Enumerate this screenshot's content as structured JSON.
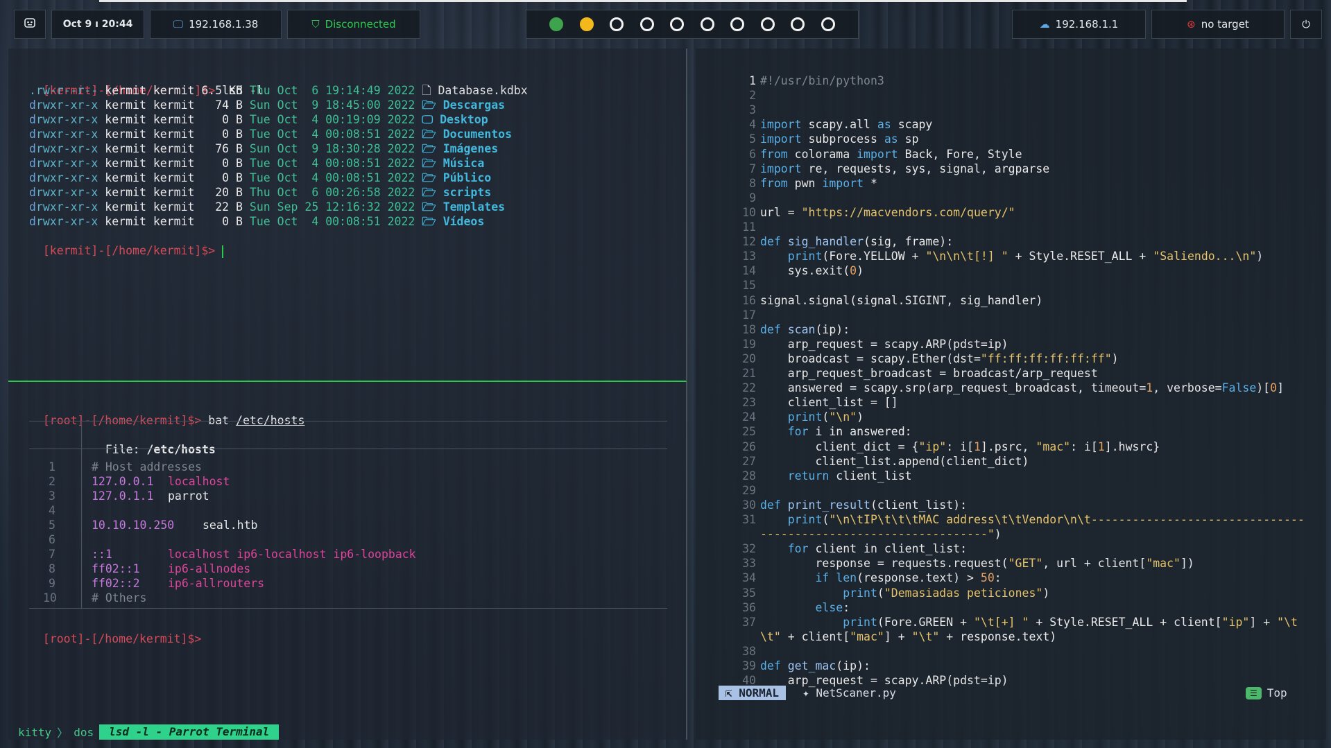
{
  "topbar": {
    "datetime": "Oct 9 ı 20:44",
    "local_ip": "192.168.1.38",
    "vpn_status": "Disconnected",
    "workspaces": [
      "active",
      "occupied",
      "empty",
      "empty",
      "empty",
      "empty",
      "empty",
      "empty",
      "empty",
      "empty"
    ],
    "gateway_ip": "192.168.1.1",
    "target": "no target",
    "colors": {
      "active": "#3fa34d",
      "occupied": "#f3b81c",
      "vpn": "#2ac94e"
    }
  },
  "terminal_top": {
    "prompt": "[kermit]-[/home/kermit]$>",
    "command": "lsd -l",
    "rows": [
      {
        "perm": ".rw-r--r--",
        "user": "kermit",
        "group": "kermit",
        "size": "6.5 KB",
        "date": "Thu Oct  6 19:14:49 2022",
        "icon": "🗋",
        "name": "Database.kdbx",
        "dir": false
      },
      {
        "perm": "drwxr-xr-x",
        "user": "kermit",
        "group": "kermit",
        "size": " 74 B",
        "date": "Sun Oct  9 18:45:00 2022",
        "icon": "🗁",
        "name": "Descargas",
        "dir": true
      },
      {
        "perm": "drwxr-xr-x",
        "user": "kermit",
        "group": "kermit",
        "size": "  0 B",
        "date": "Tue Oct  4 00:19:09 2022",
        "icon": "🖵",
        "name": "Desktop",
        "dir": true
      },
      {
        "perm": "drwxr-xr-x",
        "user": "kermit",
        "group": "kermit",
        "size": "  0 B",
        "date": "Tue Oct  4 00:08:51 2022",
        "icon": "🗁",
        "name": "Documentos",
        "dir": true
      },
      {
        "perm": "drwxr-xr-x",
        "user": "kermit",
        "group": "kermit",
        "size": " 76 B",
        "date": "Sun Oct  9 18:30:28 2022",
        "icon": "🗁",
        "name": "Imágenes",
        "dir": true
      },
      {
        "perm": "drwxr-xr-x",
        "user": "kermit",
        "group": "kermit",
        "size": "  0 B",
        "date": "Tue Oct  4 00:08:51 2022",
        "icon": "🗁",
        "name": "Música",
        "dir": true
      },
      {
        "perm": "drwxr-xr-x",
        "user": "kermit",
        "group": "kermit",
        "size": "  0 B",
        "date": "Tue Oct  4 00:08:51 2022",
        "icon": "🗁",
        "name": "Público",
        "dir": true
      },
      {
        "perm": "drwxr-xr-x",
        "user": "kermit",
        "group": "kermit",
        "size": " 20 B",
        "date": "Thu Oct  6 00:26:58 2022",
        "icon": "🗁",
        "name": "scripts",
        "dir": true
      },
      {
        "perm": "drwxr-xr-x",
        "user": "kermit",
        "group": "kermit",
        "size": " 22 B",
        "date": "Sun Sep 25 12:16:32 2022",
        "icon": "🗁",
        "name": "Templates",
        "dir": true
      },
      {
        "perm": "drwxr-xr-x",
        "user": "kermit",
        "group": "kermit",
        "size": "  0 B",
        "date": "Tue Oct  4 00:08:51 2022",
        "icon": "🗁",
        "name": "Vídeos",
        "dir": true
      }
    ],
    "prompt2": "[kermit]-[/home/kermit]$>"
  },
  "terminal_bottom": {
    "prompt": "[root]-[/home/kermit]$>",
    "command": "bat",
    "arg": "/etc/hosts",
    "file_label": "File:",
    "file_name": "/etc/hosts",
    "lines": [
      {
        "n": "1",
        "a": "# Host addresses",
        "b": "",
        "kind": "comment"
      },
      {
        "n": "2",
        "a": "127.0.0.1",
        "b": "localhost",
        "kind": "entry"
      },
      {
        "n": "3",
        "a": "127.0.1.1",
        "b": "parrot",
        "kind": "entry-white"
      },
      {
        "n": "4",
        "a": "",
        "b": "",
        "kind": "blank"
      },
      {
        "n": "5",
        "a": "10.10.10.250",
        "b": "seal.htb",
        "kind": "entry-white"
      },
      {
        "n": "6",
        "a": "",
        "b": "",
        "kind": "blank"
      },
      {
        "n": "7",
        "a": "::1",
        "b": "localhost ip6-localhost ip6-loopback",
        "kind": "entry"
      },
      {
        "n": "8",
        "a": "ff02::1",
        "b": "ip6-allnodes",
        "kind": "entry"
      },
      {
        "n": "9",
        "a": "ff02::2",
        "b": "ip6-allrouters",
        "kind": "entry"
      },
      {
        "n": "10",
        "a": "# Others",
        "b": "",
        "kind": "comment"
      }
    ],
    "prompt2": "[root]-[/home/kermit]$>"
  },
  "editor": {
    "mode": "NORMAL",
    "filename": "NetScaner.py",
    "position": "Top",
    "code": [
      {
        "n": "1",
        "t": [
          [
            "#!/usr/bin/python3",
            "comment"
          ]
        ]
      },
      {
        "n": "2",
        "t": []
      },
      {
        "n": "3",
        "t": []
      },
      {
        "n": "4",
        "t": [
          [
            "import",
            "kw"
          ],
          [
            " scapy.all ",
            "w"
          ],
          [
            "as",
            "kw"
          ],
          [
            " scapy",
            "w"
          ]
        ]
      },
      {
        "n": "5",
        "t": [
          [
            "import",
            "kw"
          ],
          [
            " subprocess ",
            "w"
          ],
          [
            "as",
            "kw"
          ],
          [
            " sp",
            "w"
          ]
        ]
      },
      {
        "n": "6",
        "t": [
          [
            "from",
            "kw"
          ],
          [
            " colorama ",
            "w"
          ],
          [
            "import",
            "kw"
          ],
          [
            " Back, Fore, Style",
            "w"
          ]
        ]
      },
      {
        "n": "7",
        "t": [
          [
            "import",
            "kw"
          ],
          [
            " re, requests, sys, signal, argparse",
            "w"
          ]
        ]
      },
      {
        "n": "8",
        "t": [
          [
            "from",
            "kw"
          ],
          [
            " pwn ",
            "w"
          ],
          [
            "import",
            "kw"
          ],
          [
            " *",
            "w"
          ]
        ]
      },
      {
        "n": "9",
        "t": []
      },
      {
        "n": "10",
        "t": [
          [
            "url = ",
            "w"
          ],
          [
            "\"https://macvendors.com/query/\"",
            "str"
          ]
        ]
      },
      {
        "n": "11",
        "t": []
      },
      {
        "n": "12",
        "t": [
          [
            "def",
            "kw"
          ],
          [
            " ",
            "w"
          ],
          [
            "sig_handler",
            "fn"
          ],
          [
            "(sig, frame):",
            "w"
          ]
        ]
      },
      {
        "n": "13",
        "t": [
          [
            "    ",
            "w"
          ],
          [
            "print",
            "kw"
          ],
          [
            "(Fore.YELLOW + ",
            "w"
          ],
          [
            "\"\\n\\n\\t[!] \"",
            "str"
          ],
          [
            " + Style.RESET_ALL + ",
            "w"
          ],
          [
            "\"Saliendo...\\n\"",
            "str"
          ],
          [
            ")",
            "w"
          ]
        ]
      },
      {
        "n": "14",
        "t": [
          [
            "    sys.exit(",
            "w"
          ],
          [
            "0",
            "num"
          ],
          [
            ")",
            "w"
          ]
        ]
      },
      {
        "n": "15",
        "t": []
      },
      {
        "n": "16",
        "t": [
          [
            "signal.signal(signal.SIGINT, sig_handler)",
            "w"
          ]
        ]
      },
      {
        "n": "17",
        "t": []
      },
      {
        "n": "18",
        "t": [
          [
            "def",
            "kw"
          ],
          [
            " ",
            "w"
          ],
          [
            "scan",
            "fn"
          ],
          [
            "(ip):",
            "w"
          ]
        ]
      },
      {
        "n": "19",
        "t": [
          [
            "    arp_request = scapy.ARP(pdst=ip)",
            "w"
          ]
        ]
      },
      {
        "n": "20",
        "t": [
          [
            "    broadcast = scapy.Ether(dst=",
            "w"
          ],
          [
            "\"ff:ff:ff:ff:ff:ff\"",
            "str"
          ],
          [
            ")",
            "w"
          ]
        ]
      },
      {
        "n": "21",
        "t": [
          [
            "    arp_request_broadcast = broadcast/arp_request",
            "w"
          ]
        ]
      },
      {
        "n": "22",
        "t": [
          [
            "    answered = scapy.srp(arp_request_broadcast, timeout=",
            "w"
          ],
          [
            "1",
            "num"
          ],
          [
            ", verbose=",
            "w"
          ],
          [
            "False",
            "kw"
          ],
          [
            ")[",
            "w"
          ],
          [
            "0",
            "num"
          ],
          [
            "]",
            "w"
          ]
        ]
      },
      {
        "n": "23",
        "t": [
          [
            "    client_list = []",
            "w"
          ]
        ]
      },
      {
        "n": "24",
        "t": [
          [
            "    ",
            "w"
          ],
          [
            "print",
            "kw"
          ],
          [
            "(",
            "w"
          ],
          [
            "\"\\n\"",
            "str"
          ],
          [
            ")",
            "w"
          ]
        ]
      },
      {
        "n": "25",
        "t": [
          [
            "    ",
            "w"
          ],
          [
            "for",
            "kw"
          ],
          [
            " i in answered:",
            "w"
          ]
        ]
      },
      {
        "n": "26",
        "t": [
          [
            "        client_dict = {",
            "w"
          ],
          [
            "\"ip\"",
            "str"
          ],
          [
            ": i[",
            "w"
          ],
          [
            "1",
            "num"
          ],
          [
            "].psrc, ",
            "w"
          ],
          [
            "\"mac\"",
            "str"
          ],
          [
            ": i[",
            "w"
          ],
          [
            "1",
            "num"
          ],
          [
            "].hwsrc}",
            "w"
          ]
        ]
      },
      {
        "n": "27",
        "t": [
          [
            "        client_list.append(client_dict)",
            "w"
          ]
        ]
      },
      {
        "n": "28",
        "t": [
          [
            "    ",
            "w"
          ],
          [
            "return",
            "kw"
          ],
          [
            " client_list",
            "w"
          ]
        ]
      },
      {
        "n": "29",
        "t": []
      },
      {
        "n": "30",
        "t": [
          [
            "def",
            "kw"
          ],
          [
            " ",
            "w"
          ],
          [
            "print_result",
            "fn"
          ],
          [
            "(client_list):",
            "w"
          ]
        ]
      },
      {
        "n": "31",
        "t": [
          [
            "    ",
            "w"
          ],
          [
            "print",
            "kw"
          ],
          [
            "(",
            "w"
          ],
          [
            "\"\\n\\tIP\\t\\t\\tMAC address\\t\\tVendor\\n\\t-------------------------------",
            "str"
          ]
        ]
      },
      {
        "n": "",
        "t": [
          [
            "---------------------------------\"",
            "str"
          ],
          [
            ")",
            "w"
          ]
        ]
      },
      {
        "n": "32",
        "t": [
          [
            "    ",
            "w"
          ],
          [
            "for",
            "kw"
          ],
          [
            " client in client_list:",
            "w"
          ]
        ]
      },
      {
        "n": "33",
        "t": [
          [
            "        response = requests.request(",
            "w"
          ],
          [
            "\"GET\"",
            "str"
          ],
          [
            ", url + client[",
            "w"
          ],
          [
            "\"mac\"",
            "str"
          ],
          [
            "])",
            "w"
          ]
        ]
      },
      {
        "n": "34",
        "t": [
          [
            "        ",
            "w"
          ],
          [
            "if",
            "kw"
          ],
          [
            " ",
            "w"
          ],
          [
            "len",
            "kw"
          ],
          [
            "(response.text) > ",
            "w"
          ],
          [
            "50",
            "num"
          ],
          [
            ":",
            "w"
          ]
        ]
      },
      {
        "n": "35",
        "t": [
          [
            "            ",
            "w"
          ],
          [
            "print",
            "kw"
          ],
          [
            "(",
            "w"
          ],
          [
            "\"Demasiadas peticiones\"",
            "str"
          ],
          [
            ")",
            "w"
          ]
        ]
      },
      {
        "n": "36",
        "t": [
          [
            "        ",
            "w"
          ],
          [
            "else",
            "kw"
          ],
          [
            ":",
            "w"
          ]
        ]
      },
      {
        "n": "37",
        "t": [
          [
            "            ",
            "w"
          ],
          [
            "print",
            "kw"
          ],
          [
            "(Fore.GREEN + ",
            "w"
          ],
          [
            "\"\\t[+] \"",
            "str"
          ],
          [
            " + Style.RESET_ALL + client[",
            "w"
          ],
          [
            "\"ip\"",
            "str"
          ],
          [
            "] + ",
            "w"
          ],
          [
            "\"\\t",
            "str"
          ]
        ]
      },
      {
        "n": "",
        "t": [
          [
            "\\t\"",
            "str"
          ],
          [
            " + client[",
            "w"
          ],
          [
            "\"mac\"",
            "str"
          ],
          [
            "] + ",
            "w"
          ],
          [
            "\"\\t\"",
            "str"
          ],
          [
            " + response.text)",
            "w"
          ]
        ]
      },
      {
        "n": "38",
        "t": []
      },
      {
        "n": "39",
        "t": [
          [
            "def",
            "kw"
          ],
          [
            " ",
            "w"
          ],
          [
            "get_mac",
            "fn"
          ],
          [
            "(ip):",
            "w"
          ]
        ]
      },
      {
        "n": "40",
        "t": [
          [
            "    arp_request = scapy.ARP(pdst=ip)",
            "w"
          ]
        ]
      }
    ]
  },
  "kitty": {
    "app": "kitty",
    "session": "dos",
    "active_title": "lsd -l - Parrot Terminal"
  }
}
